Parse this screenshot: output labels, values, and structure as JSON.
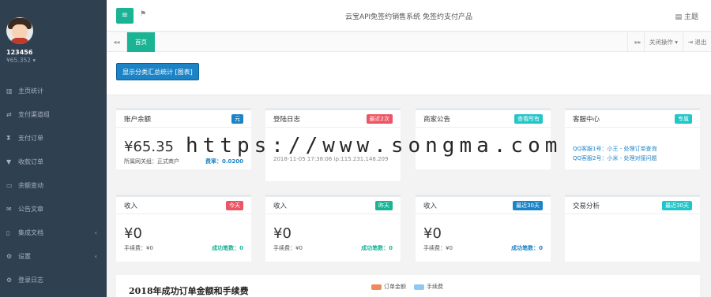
{
  "user": {
    "name": "123456",
    "balance": "¥65.352 ▾"
  },
  "sidebar": {
    "items": [
      {
        "label": "主页统计",
        "icon": "bar-chart-icon",
        "glyph": "▥",
        "arrow": ""
      },
      {
        "label": "支付渠道组",
        "icon": "exchange-icon",
        "glyph": "⇄",
        "arrow": ""
      },
      {
        "label": "支付订单",
        "icon": "hourglass-icon",
        "glyph": "⧗",
        "arrow": ""
      },
      {
        "label": "收款订单",
        "icon": "filter-icon",
        "glyph": "▼",
        "arrow": ""
      },
      {
        "label": "余额变动",
        "icon": "money-icon",
        "glyph": "▭",
        "arrow": ""
      },
      {
        "label": "公告文章",
        "icon": "envelope-icon",
        "glyph": "✉",
        "arrow": ""
      },
      {
        "label": "集成文档",
        "icon": "file-icon",
        "glyph": "▯",
        "arrow": "‹"
      },
      {
        "label": "设置",
        "icon": "cogs-icon",
        "glyph": "⚙",
        "arrow": "‹"
      },
      {
        "label": "登录日志",
        "icon": "gear-icon",
        "glyph": "⚙",
        "arrow": ""
      }
    ]
  },
  "topbar": {
    "menu_glyph": "≡",
    "flag_glyph": "⚑",
    "title": "云宝API免签约销售系统 免签约支付产品",
    "theme_label": "▤ 主题"
  },
  "tabs": {
    "left_glyph": "◂◂",
    "home_label": "首页",
    "right_glyph": "▸▸",
    "close_label": "关闭操作 ▾",
    "logout_label": "⇥ 退出"
  },
  "summary_button": "显示分类汇总统计 [图表]",
  "cards": {
    "balance": {
      "title": "账户余额",
      "badge": "元",
      "value": "¥65.35",
      "left": "所属网关组：正式商户",
      "right": "费率：0.0200"
    },
    "login_log": {
      "title": "登陆日志",
      "badge": "最近2次",
      "text": "2018-11-05 17:38:06 ip:115.231.148.209"
    },
    "notice": {
      "title": "商家公告",
      "badge": "查看所有"
    },
    "service": {
      "title": "客服中心",
      "badge": "专属",
      "line1": "QQ客服1号：小王 - 处理订单查询",
      "line2": "QQ客服2号：小米 - 处理对接问题"
    },
    "income_today": {
      "title": "收入",
      "badge": "今天",
      "value": "¥0",
      "left": "手续费：¥0",
      "right": "成功笔数：0"
    },
    "income_yesterday": {
      "title": "收入",
      "badge": "昨天",
      "value": "¥0",
      "left": "手续费：¥0",
      "right": "成功笔数：0"
    },
    "income_30": {
      "title": "收入",
      "badge": "最近30天",
      "value": "¥0",
      "left": "手续费：¥0",
      "right": "成功笔数：0"
    },
    "trade": {
      "title": "交易分析",
      "badge": "最近30天"
    }
  },
  "chart": {
    "title": "2018年成功订单金额和手续费",
    "legend": [
      {
        "label": "订单金额",
        "color": "#f08a5d"
      },
      {
        "label": "手续费",
        "color": "#8ec9f0"
      }
    ]
  },
  "watermark": "https://www.songma.com"
}
